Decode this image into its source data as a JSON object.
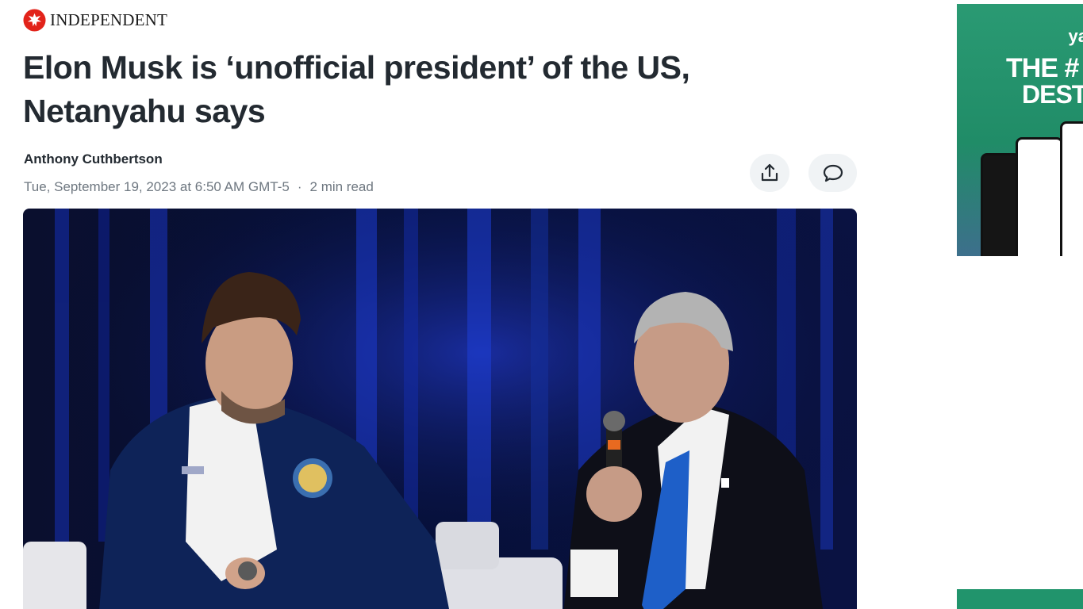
{
  "publisher": {
    "name": "INDEPENDENT",
    "logo_icon": "eagle-logo-icon"
  },
  "article": {
    "headline_line1": "Elon Musk is ‘unofficial president’ of the US,",
    "headline_line2": "Netanyahu says",
    "author": "Anthony Cuthbertson",
    "date": "Tue, September 19, 2023 at 6:50 AM GMT-5",
    "separator": "·",
    "read_time": "2 min read"
  },
  "actions": {
    "share_icon": "share-icon",
    "comment_icon": "comment-icon"
  },
  "hero": {
    "description_icon": "photo"
  },
  "ad": {
    "brand": "ya",
    "line1": "THE #",
    "line2": "DEST",
    "colors": {
      "background": "#208c67"
    }
  },
  "colors": {
    "text": "#232a31",
    "meta": "#6e7780",
    "logo_red": "#e2231a"
  }
}
